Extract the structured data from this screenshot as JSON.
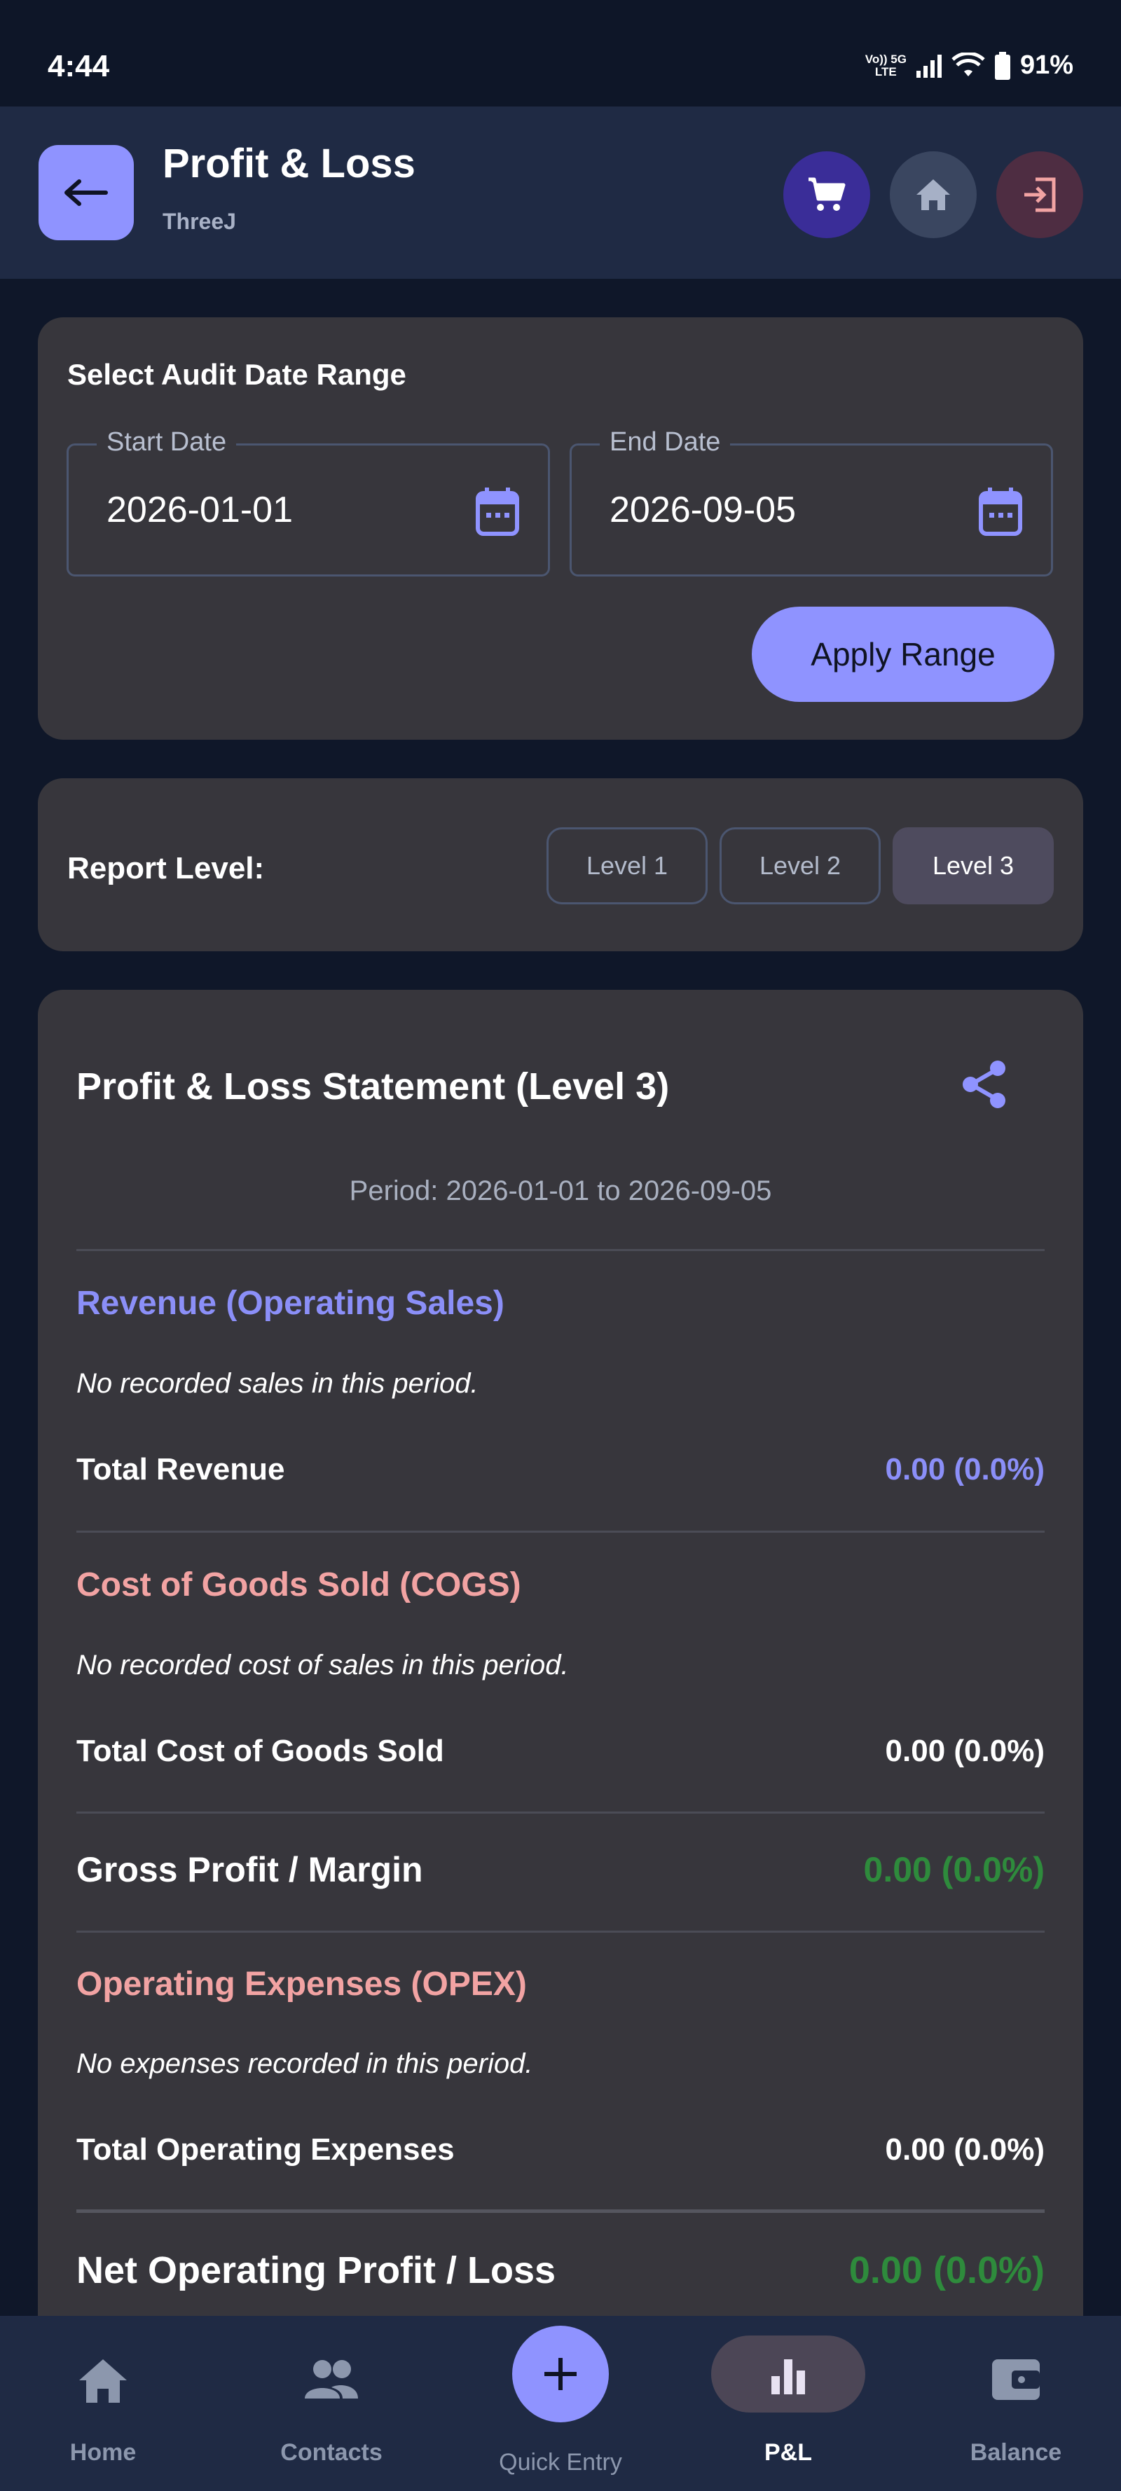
{
  "status_bar": {
    "time": "4:44",
    "net_top": "Vo)) 5G",
    "net_bottom": "LTE",
    "battery": "91%"
  },
  "header": {
    "title": "Profit & Loss",
    "subtitle": "ThreeJ"
  },
  "date_range": {
    "heading": "Select Audit Date Range",
    "start_label": "Start Date",
    "start_value": "2026-01-01",
    "end_label": "End Date",
    "end_value": "2026-09-05",
    "apply_label": "Apply Range"
  },
  "report_level": {
    "label": "Report Level:",
    "levels": [
      "Level 1",
      "Level 2",
      "Level 3"
    ],
    "selected": "Level 3"
  },
  "statement": {
    "title": "Profit & Loss Statement (Level 3)",
    "period": "Period: 2026-01-01 to 2026-09-05",
    "revenue": {
      "title": "Revenue (Operating Sales)",
      "note": "No recorded sales in this period.",
      "total_label": "Total Revenue",
      "total_value": "0.00 (0.0%)"
    },
    "cogs": {
      "title": "Cost of Goods Sold (COGS)",
      "note": "No recorded cost of sales in this period.",
      "total_label": "Total Cost of Goods Sold",
      "total_value": "0.00 (0.0%)"
    },
    "gross": {
      "label": "Gross Profit / Margin",
      "value": "0.00 (0.0%)"
    },
    "opex": {
      "title": "Operating Expenses (OPEX)",
      "note": "No expenses recorded in this period.",
      "total_label": "Total Operating Expenses",
      "total_value": "0.00 (0.0%)"
    },
    "net": {
      "label": "Net Operating Profit / Loss",
      "value": "0.00 (0.0%)"
    }
  },
  "bottom_nav": {
    "home": "Home",
    "contacts": "Contacts",
    "quick_entry": "Quick Entry",
    "pl": "P&L",
    "balance": "Balance"
  },
  "colors": {
    "accent": "#8f93ff",
    "revenue": "#8b8ff8",
    "expense": "#f2a3a3",
    "profit": "#2e8b3c",
    "card": "#37363c",
    "app_bar": "#1f2a44",
    "background": "#0f1729"
  },
  "icons": [
    "back-arrow-icon",
    "cart-icon",
    "home-icon",
    "exit-icon",
    "calendar-icon",
    "share-icon",
    "contacts-icon",
    "plus-icon",
    "bar-chart-icon",
    "wallet-icon"
  ]
}
